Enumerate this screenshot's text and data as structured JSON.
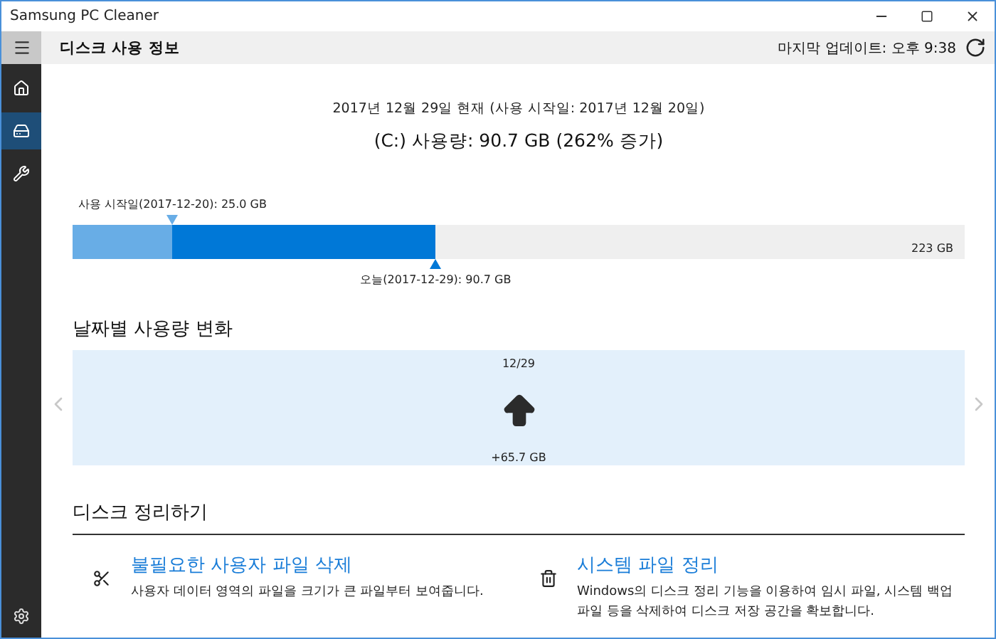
{
  "window": {
    "title": "Samsung PC Cleaner"
  },
  "header": {
    "title": "디스크 사용 정보",
    "last_update": "마지막 업데이트: 오후 9:38"
  },
  "sidebar": {
    "items": [
      {
        "kind": "home",
        "selected": false
      },
      {
        "kind": "disk",
        "selected": true
      },
      {
        "kind": "tools",
        "selected": false
      }
    ]
  },
  "summary": {
    "date_line": "2017년 12월 29일 현재 (사용 시작일: 2017년 12월 20일)",
    "usage_line": "(C:) 사용량: 90.7 GB (262% 증가)"
  },
  "usage_bar": {
    "start": {
      "label": "사용 시작일(2017-12-20): 25.0 GB",
      "level": 0.112
    },
    "today": {
      "label": "오늘(2017-12-29): 90.7 GB",
      "level": 0.407
    },
    "capacity": "223 GB"
  },
  "daily_change": {
    "title": "날짜별 사용량 변화",
    "date": "12/29",
    "amount": "+65.7 GB"
  },
  "cleanup": {
    "title": "디스크 정리하기",
    "items": [
      {
        "kind": "scissors",
        "title": "불필요한 사용자 파일 삭제",
        "description": "사용자 데이터 영역의 파일을 크기가 큰 파일부터 보여줍니다."
      },
      {
        "kind": "trash",
        "title": "시스템 파일 정리",
        "description": "Windows의 디스크 정리 기능을 이용하여 임시 파일, 시스템 백업 파일 등을 삭제하여 디스크 저장 공간을 확보합니다."
      }
    ]
  }
}
